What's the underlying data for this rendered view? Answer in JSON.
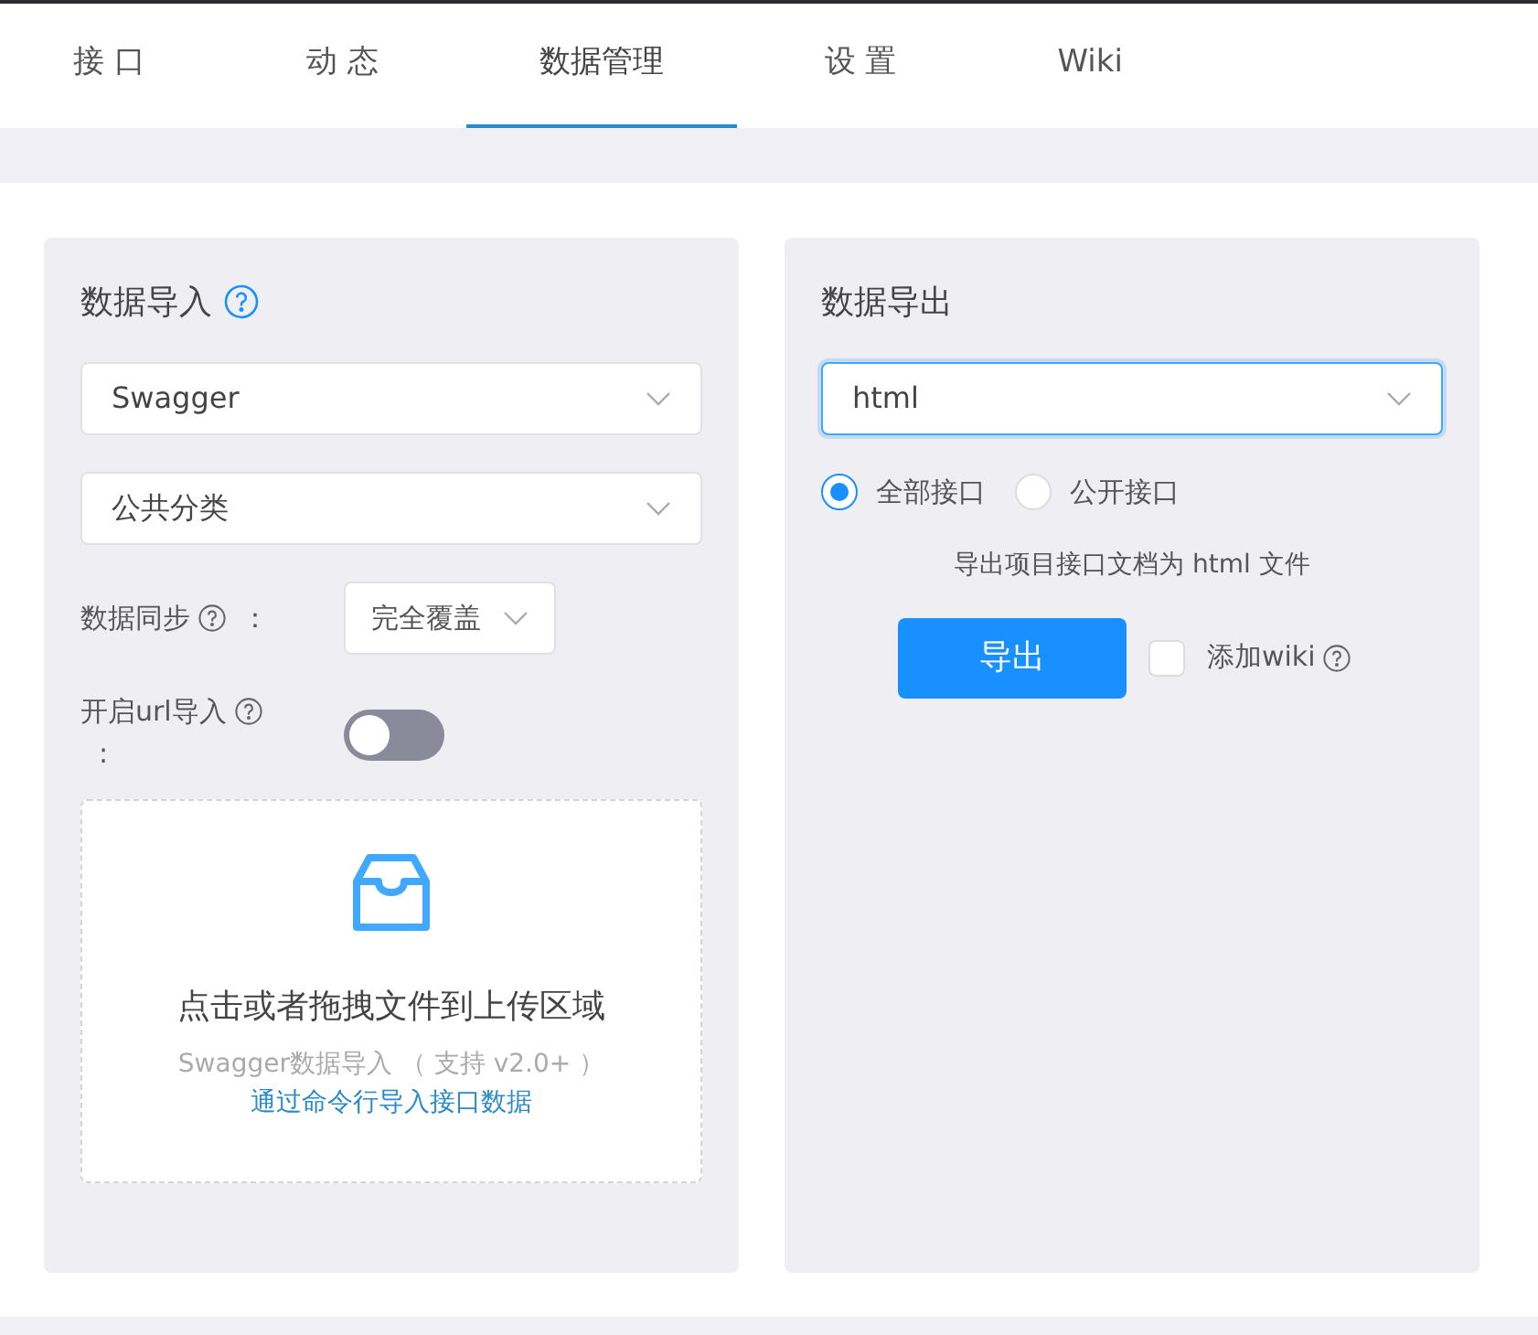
{
  "tabs": [
    {
      "label": "接 口",
      "selected": false
    },
    {
      "label": "动 态",
      "selected": false
    },
    {
      "label": "数据管理",
      "selected": true
    },
    {
      "label": "设 置",
      "selected": false
    },
    {
      "label": "Wiki",
      "selected": false
    }
  ],
  "import_panel": {
    "title": "数据导入",
    "selects": [
      {
        "value": "Swagger"
      },
      {
        "value": "公共分类"
      }
    ],
    "sync": {
      "label": "数据同步",
      "colon": "：",
      "value": "完全覆盖"
    },
    "url_import": {
      "label": "开启url导入",
      "colon": ":",
      "on": false
    },
    "upload": {
      "title": "点击或者拖拽文件到上传区域",
      "hint": "Swagger数据导入 （ 支持 v2.0+ ）",
      "link": "通过命令行导入接口数据"
    }
  },
  "export_panel": {
    "title": "数据导出",
    "select": {
      "value": "html"
    },
    "radios": [
      {
        "label": "全部接口",
        "selected": true
      },
      {
        "label": "公开接口",
        "selected": false
      }
    ],
    "description": "导出项目接口文档为 html 文件",
    "button": "导出",
    "checkbox": {
      "label": "添加wiki",
      "checked": false
    }
  }
}
